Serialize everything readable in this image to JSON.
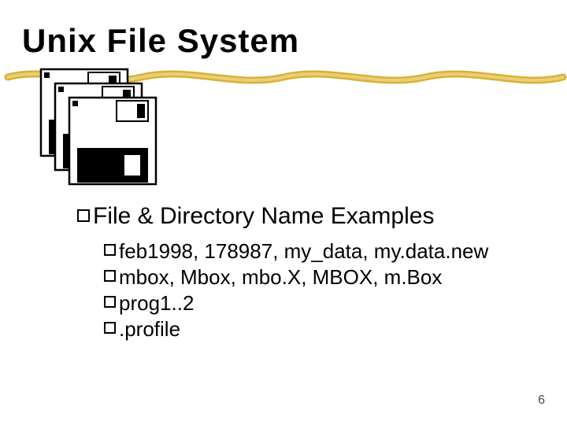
{
  "title": "Unix File System",
  "heading": "File & Directory Name Examples",
  "items": [
    "feb1998, 178987, my_data, my.data.new",
    "mbox, Mbox, mbo.X, MBOX, m.Box",
    "prog1..2",
    ".profile"
  ],
  "page_number": "6"
}
